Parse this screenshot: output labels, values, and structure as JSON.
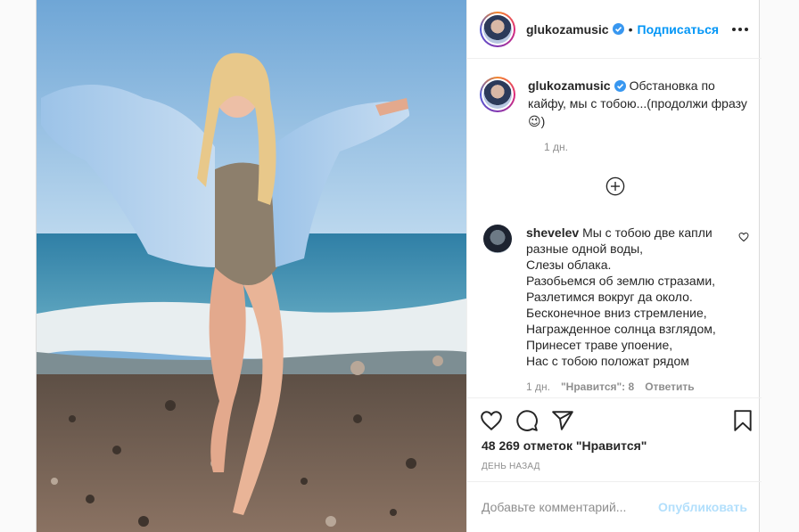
{
  "post": {
    "author": {
      "username": "glukozamusic",
      "verified_icon": "verified-badge-icon",
      "follow_label": "Подписаться",
      "separator": "•"
    },
    "caption": {
      "username": "glukozamusic",
      "text": "Обстановка по кайфу, мы с тобою...(продолжи фразу 😉)",
      "time": "1 дн."
    },
    "comments": [
      {
        "username": "shevelev",
        "lines": [
          "Мы с тобою две капли",
          "разные одной воды,",
          "Слезы облака.",
          "Разобьемся об землю стразами,",
          "Разлетимся вокруг да около.",
          "Бесконечное вниз стремление,",
          "Награжденное солнца взглядом,",
          "Принесет траве упоение,",
          "Нас с тобою положат рядом"
        ],
        "time": "1 дн.",
        "likes": "\"Нравится\": 8",
        "reply_label": "Ответить"
      }
    ],
    "likes_text": "48 269 отметок \"Нравится\"",
    "posted_ago": "День назад",
    "add_comment": {
      "placeholder": "Добавьте комментарий...",
      "publish_label": "Опубликовать"
    },
    "colors": {
      "accent": "#0095f6",
      "publish_disabled": "#b2dffc",
      "muted": "#8e8e8e"
    }
  }
}
